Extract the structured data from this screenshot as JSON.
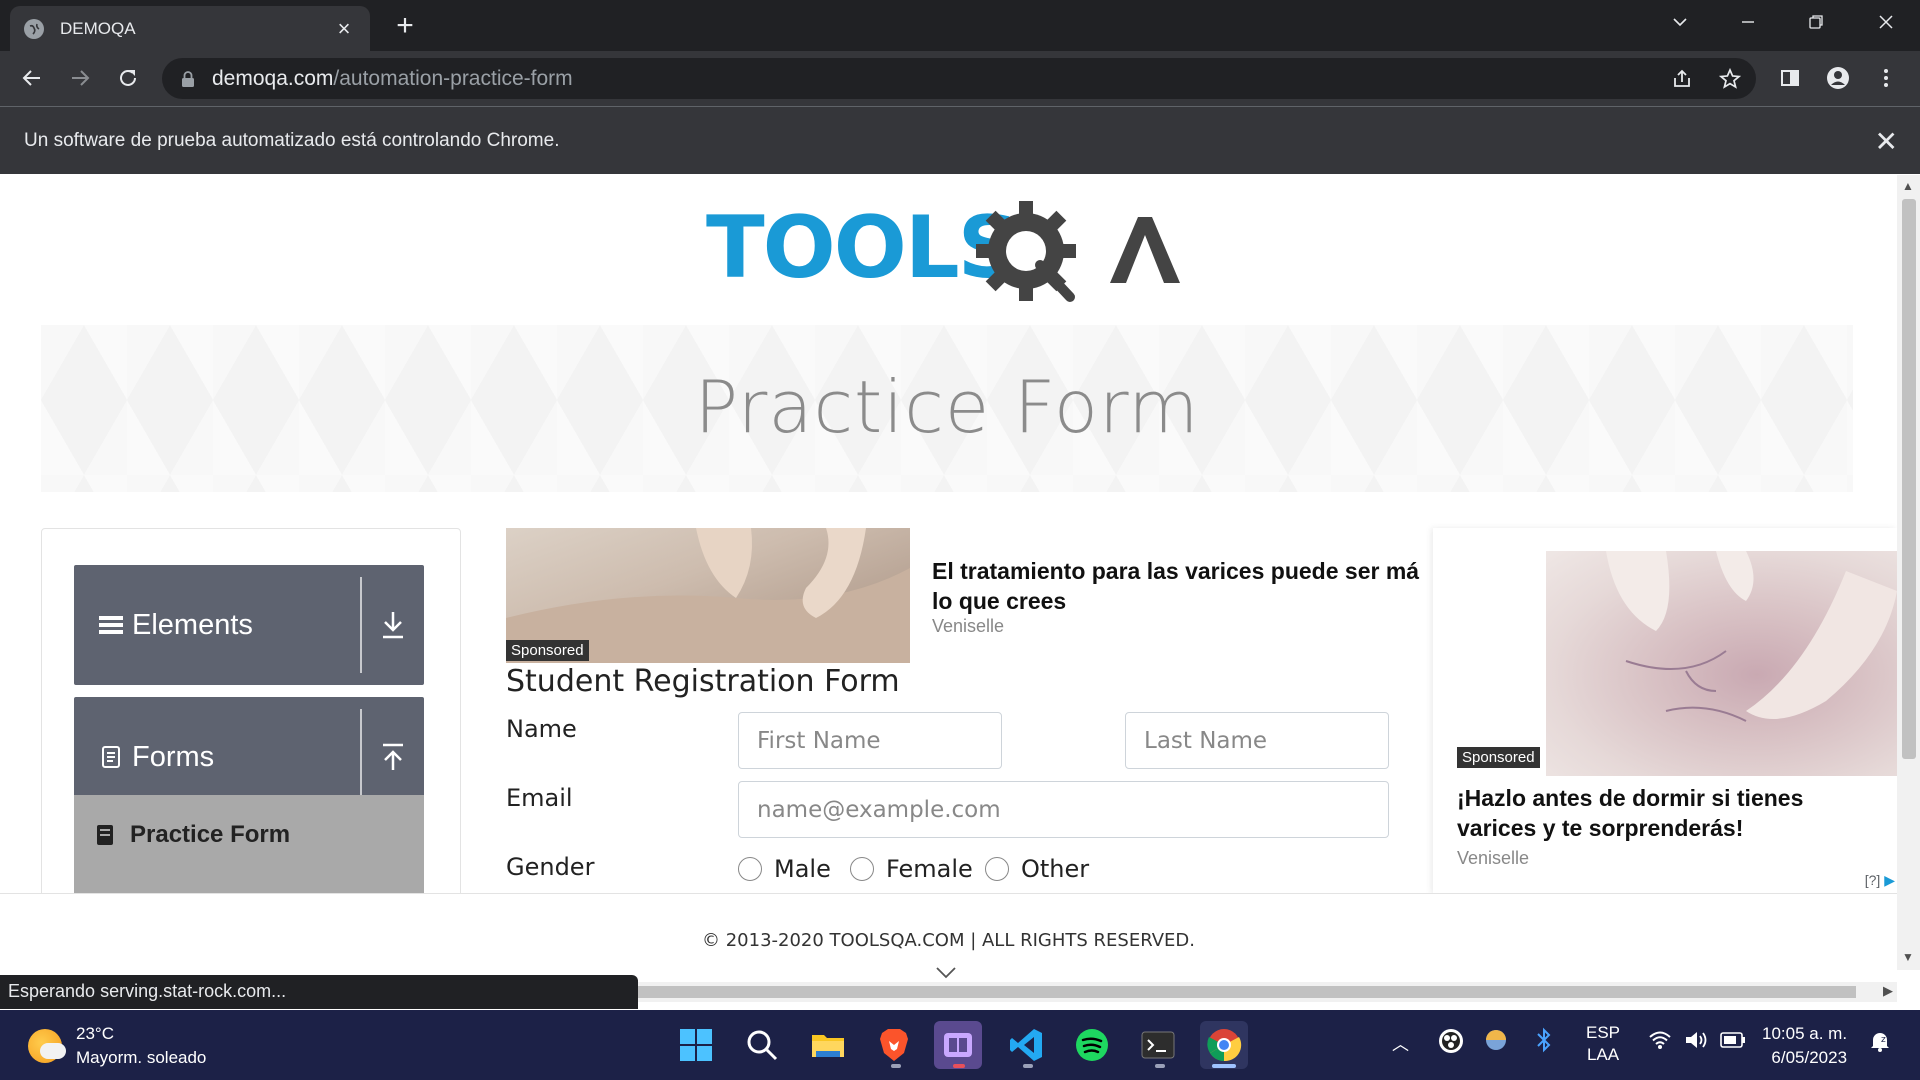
{
  "browser": {
    "tab_title": "DEMOQA",
    "tab_close": "×",
    "new_tab": "+",
    "url_domain": "demoqa.com",
    "url_path": "/automation-practice-form",
    "infobar_text": "Un software de prueba automatizado está controlando Chrome.",
    "infobar_close": "✕",
    "status_text": "Esperando serving.stat-rock.com..."
  },
  "page": {
    "logo_text": "TOOLSQA",
    "heading": "Practice Form",
    "sidebar": {
      "groups": [
        {
          "label": "Elements"
        },
        {
          "label": "Forms"
        }
      ],
      "active_item": "Practice Form"
    },
    "ad_top": {
      "sponsored": "Sponsored",
      "headline": "El tratamiento para las varices puede ser má lo que crees",
      "brand": "Veniselle"
    },
    "form": {
      "title": "Student Registration Form",
      "name_label": "Name",
      "first_name_placeholder": "First Name",
      "last_name_placeholder": "Last Name",
      "email_label": "Email",
      "email_placeholder": "name@example.com",
      "gender_label": "Gender",
      "gender_options": [
        "Male",
        "Female",
        "Other"
      ]
    },
    "ad_right": {
      "sponsored": "Sponsored",
      "headline": "¡Hazlo antes de dormir si tienes varices y te sorprenderás!",
      "brand": "Veniselle",
      "adchoice": "[?]"
    },
    "footer": "© 2013-2020 TOOLSQA.COM | ALL RIGHTS RESERVED."
  },
  "taskbar": {
    "weather_temp": "23°C",
    "weather_desc": "Mayorm. soleado",
    "language_top": "ESP",
    "language_bottom": "LAA",
    "time": "10:05 a. m.",
    "date": "6/05/2023"
  },
  "colors": {
    "toolsqa_blue": "#1a9ad6",
    "toolsqa_gray": "#444444",
    "sidebar_group": "#5e6370",
    "sidebar_active": "#a9a9a9",
    "taskbar": "#1c2147"
  }
}
